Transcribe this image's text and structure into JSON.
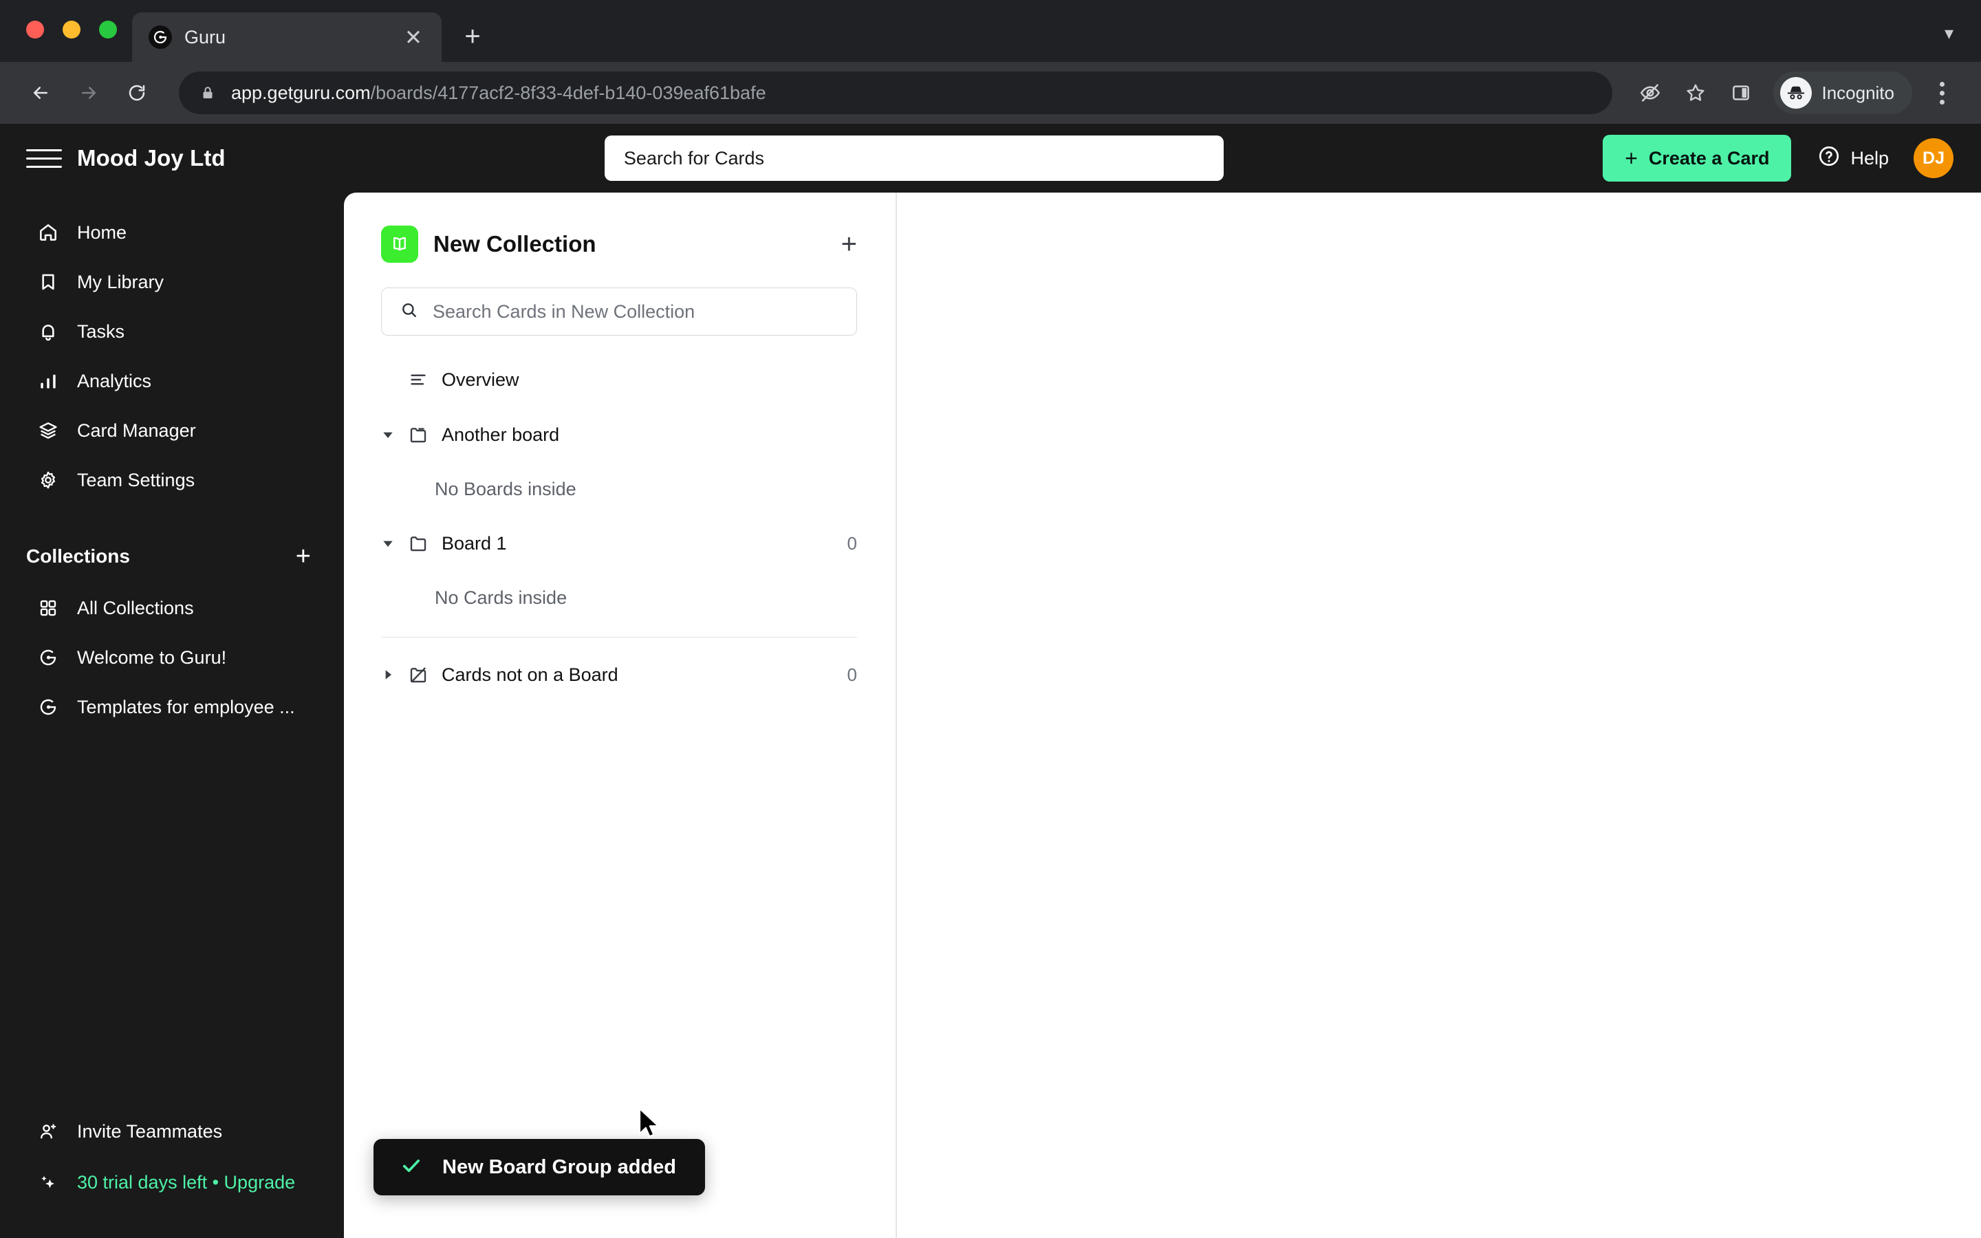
{
  "browser": {
    "tab": {
      "title": "Guru",
      "favicon_icon": "guru-logo-icon",
      "close_icon": "close-icon"
    },
    "new_tab_icon": "plus-icon",
    "tab_list_icon": "chevron-down-icon",
    "back_icon": "back-arrow-icon",
    "forward_icon": "forward-arrow-icon",
    "reload_icon": "reload-icon",
    "lock_icon": "lock-icon",
    "url_host": "app.getguru.com",
    "url_path": "/boards/4177acf2-8f33-4def-b140-039eaf61bafe",
    "tracking_icon": "eye-slash-icon",
    "bookmark_icon": "star-icon",
    "side_panel_icon": "side-panel-icon",
    "incognito_label": "Incognito",
    "incognito_icon": "incognito-hat-icon",
    "menu_icon": "kebab-menu-icon"
  },
  "header": {
    "menu_icon": "hamburger-icon",
    "brand": "Mood Joy Ltd",
    "search_placeholder": "Search for Cards",
    "create_card_label": "Create a Card",
    "create_card_icon": "plus-icon",
    "create_card_color": "#4EF2A7",
    "help_label": "Help",
    "help_icon": "question-circle-icon",
    "avatar_initials": "DJ",
    "avatar_color": "#F59402"
  },
  "sidebar": {
    "nav": [
      {
        "label": "Home",
        "icon": "home-icon"
      },
      {
        "label": "My Library",
        "icon": "bookmark-icon"
      },
      {
        "label": "Tasks",
        "icon": "bell-icon"
      },
      {
        "label": "Analytics",
        "icon": "bar-chart-icon"
      },
      {
        "label": "Card Manager",
        "icon": "layers-icon"
      },
      {
        "label": "Team Settings",
        "icon": "gear-icon"
      }
    ],
    "collections_title": "Collections",
    "collections_add_icon": "plus-icon",
    "collections": [
      {
        "label": "All Collections",
        "icon": "grid-icon"
      },
      {
        "label": "Welcome to Guru!",
        "icon": "guru-logo-icon"
      },
      {
        "label": "Templates for employee ...",
        "icon": "guru-logo-icon"
      }
    ],
    "footer": [
      {
        "label": "Invite Teammates",
        "icon": "person-plus-icon"
      },
      {
        "label": "30 trial days left • Upgrade",
        "icon": "sparkle-icon",
        "color": "#4EF2A7"
      }
    ]
  },
  "panel": {
    "collection_name": "New Collection",
    "collection_badge_icon": "open-book-icon",
    "collection_badge_color": "#3BED2E",
    "add_icon": "plus-icon",
    "search_placeholder": "Search Cards in New Collection",
    "search_icon": "search-icon",
    "tree": [
      {
        "label": "Overview",
        "icon": "overview-lines-icon",
        "caret": "none",
        "count": ""
      },
      {
        "label": "Another board",
        "icon": "folder-open-icon",
        "caret": "expanded",
        "count": ""
      },
      {
        "label": "No Boards inside",
        "type": "empty"
      },
      {
        "label": "Board 1",
        "icon": "folder-icon",
        "caret": "expanded",
        "count": "0"
      },
      {
        "label": "No Cards inside",
        "type": "empty"
      },
      {
        "type": "separator"
      },
      {
        "label": "Cards not on a Board",
        "icon": "folder-slash-icon",
        "caret": "collapsed",
        "count": "0"
      }
    ]
  },
  "toast": {
    "message": "New Board Group added",
    "icon": "check-icon",
    "icon_color": "#4EF2A7"
  }
}
